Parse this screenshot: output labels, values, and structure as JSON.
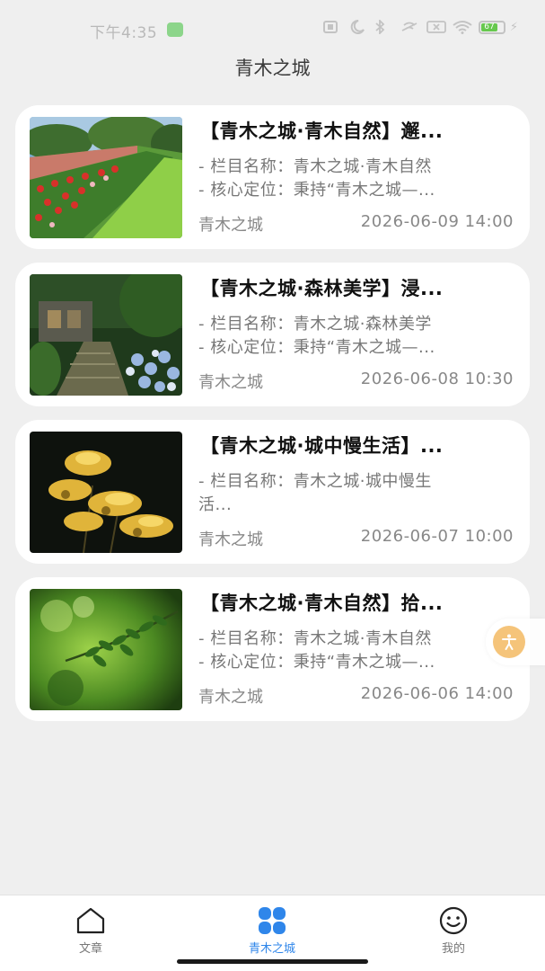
{
  "status_bar": {
    "time": "下午4:35",
    "battery": "67"
  },
  "header": {
    "title": "青木之城"
  },
  "articles": [
    {
      "title": "【青木之城·青木自然】邂...",
      "desc_line1": "- 栏目名称：青木之城·青木自然",
      "desc_line2": "- 核心定位：秉持“青木之城—...",
      "source": "青木之城",
      "date": "2026-06-09 14:00"
    },
    {
      "title": "【青木之城·森林美学】浸...",
      "desc_line1": "- 栏目名称：青木之城·森林美学",
      "desc_line2": "- 核心定位：秉持“青木之城—...",
      "source": "青木之城",
      "date": "2026-06-08 10:30"
    },
    {
      "title": "【青木之城·城中慢生活】...",
      "desc_line1": "- 栏目名称：青木之城·城中慢生",
      "desc_line2": "活...",
      "source": "青木之城",
      "date": "2026-06-07 10:00"
    },
    {
      "title": "【青木之城·青木自然】拾...",
      "desc_line1": "- 栏目名称：青木之城·青木自然",
      "desc_line2": "- 核心定位：秉持“青木之城—...",
      "source": "青木之城",
      "date": "2026-06-06 14:00"
    }
  ],
  "tab_bar": {
    "tabs": [
      {
        "label": "文章",
        "icon": "home-icon"
      },
      {
        "label": "青木之城",
        "icon": "clover-icon",
        "active": true
      },
      {
        "label": "我的",
        "icon": "smiley-icon"
      }
    ]
  },
  "colors": {
    "accent": "#2f86ea",
    "background": "#efefef",
    "float_button": "#f5c47a"
  }
}
